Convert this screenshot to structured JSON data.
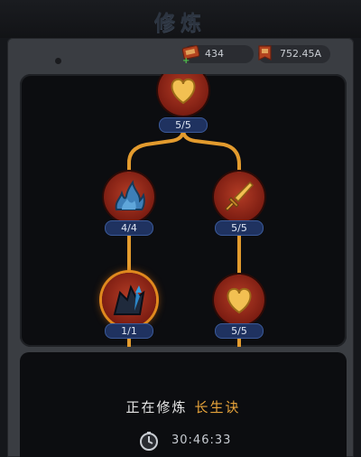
{
  "header": {
    "title": "修炼"
  },
  "resources": [
    {
      "icon": "scroll-plus-icon",
      "value": "434"
    },
    {
      "icon": "scroll-icon",
      "value": "752.45A"
    }
  ],
  "skill_tree": {
    "nodes": [
      {
        "id": "top",
        "icon": "heart-icon",
        "count": "5/5"
      },
      {
        "id": "left-mid",
        "icon": "flame-icon",
        "count": "4/4"
      },
      {
        "id": "right-mid",
        "icon": "sword-icon",
        "count": "5/5"
      },
      {
        "id": "left-bottom",
        "icon": "spike-icon",
        "count": "1/1"
      },
      {
        "id": "right-bottom",
        "icon": "heart-icon",
        "count": "5/5"
      }
    ],
    "colors": {
      "line": "#e39b2e",
      "node": "#9a2a17",
      "badge": "#1f3260"
    }
  },
  "cultivation": {
    "label": "正在修炼",
    "skill": "长生诀",
    "timer": "30:46:33"
  }
}
